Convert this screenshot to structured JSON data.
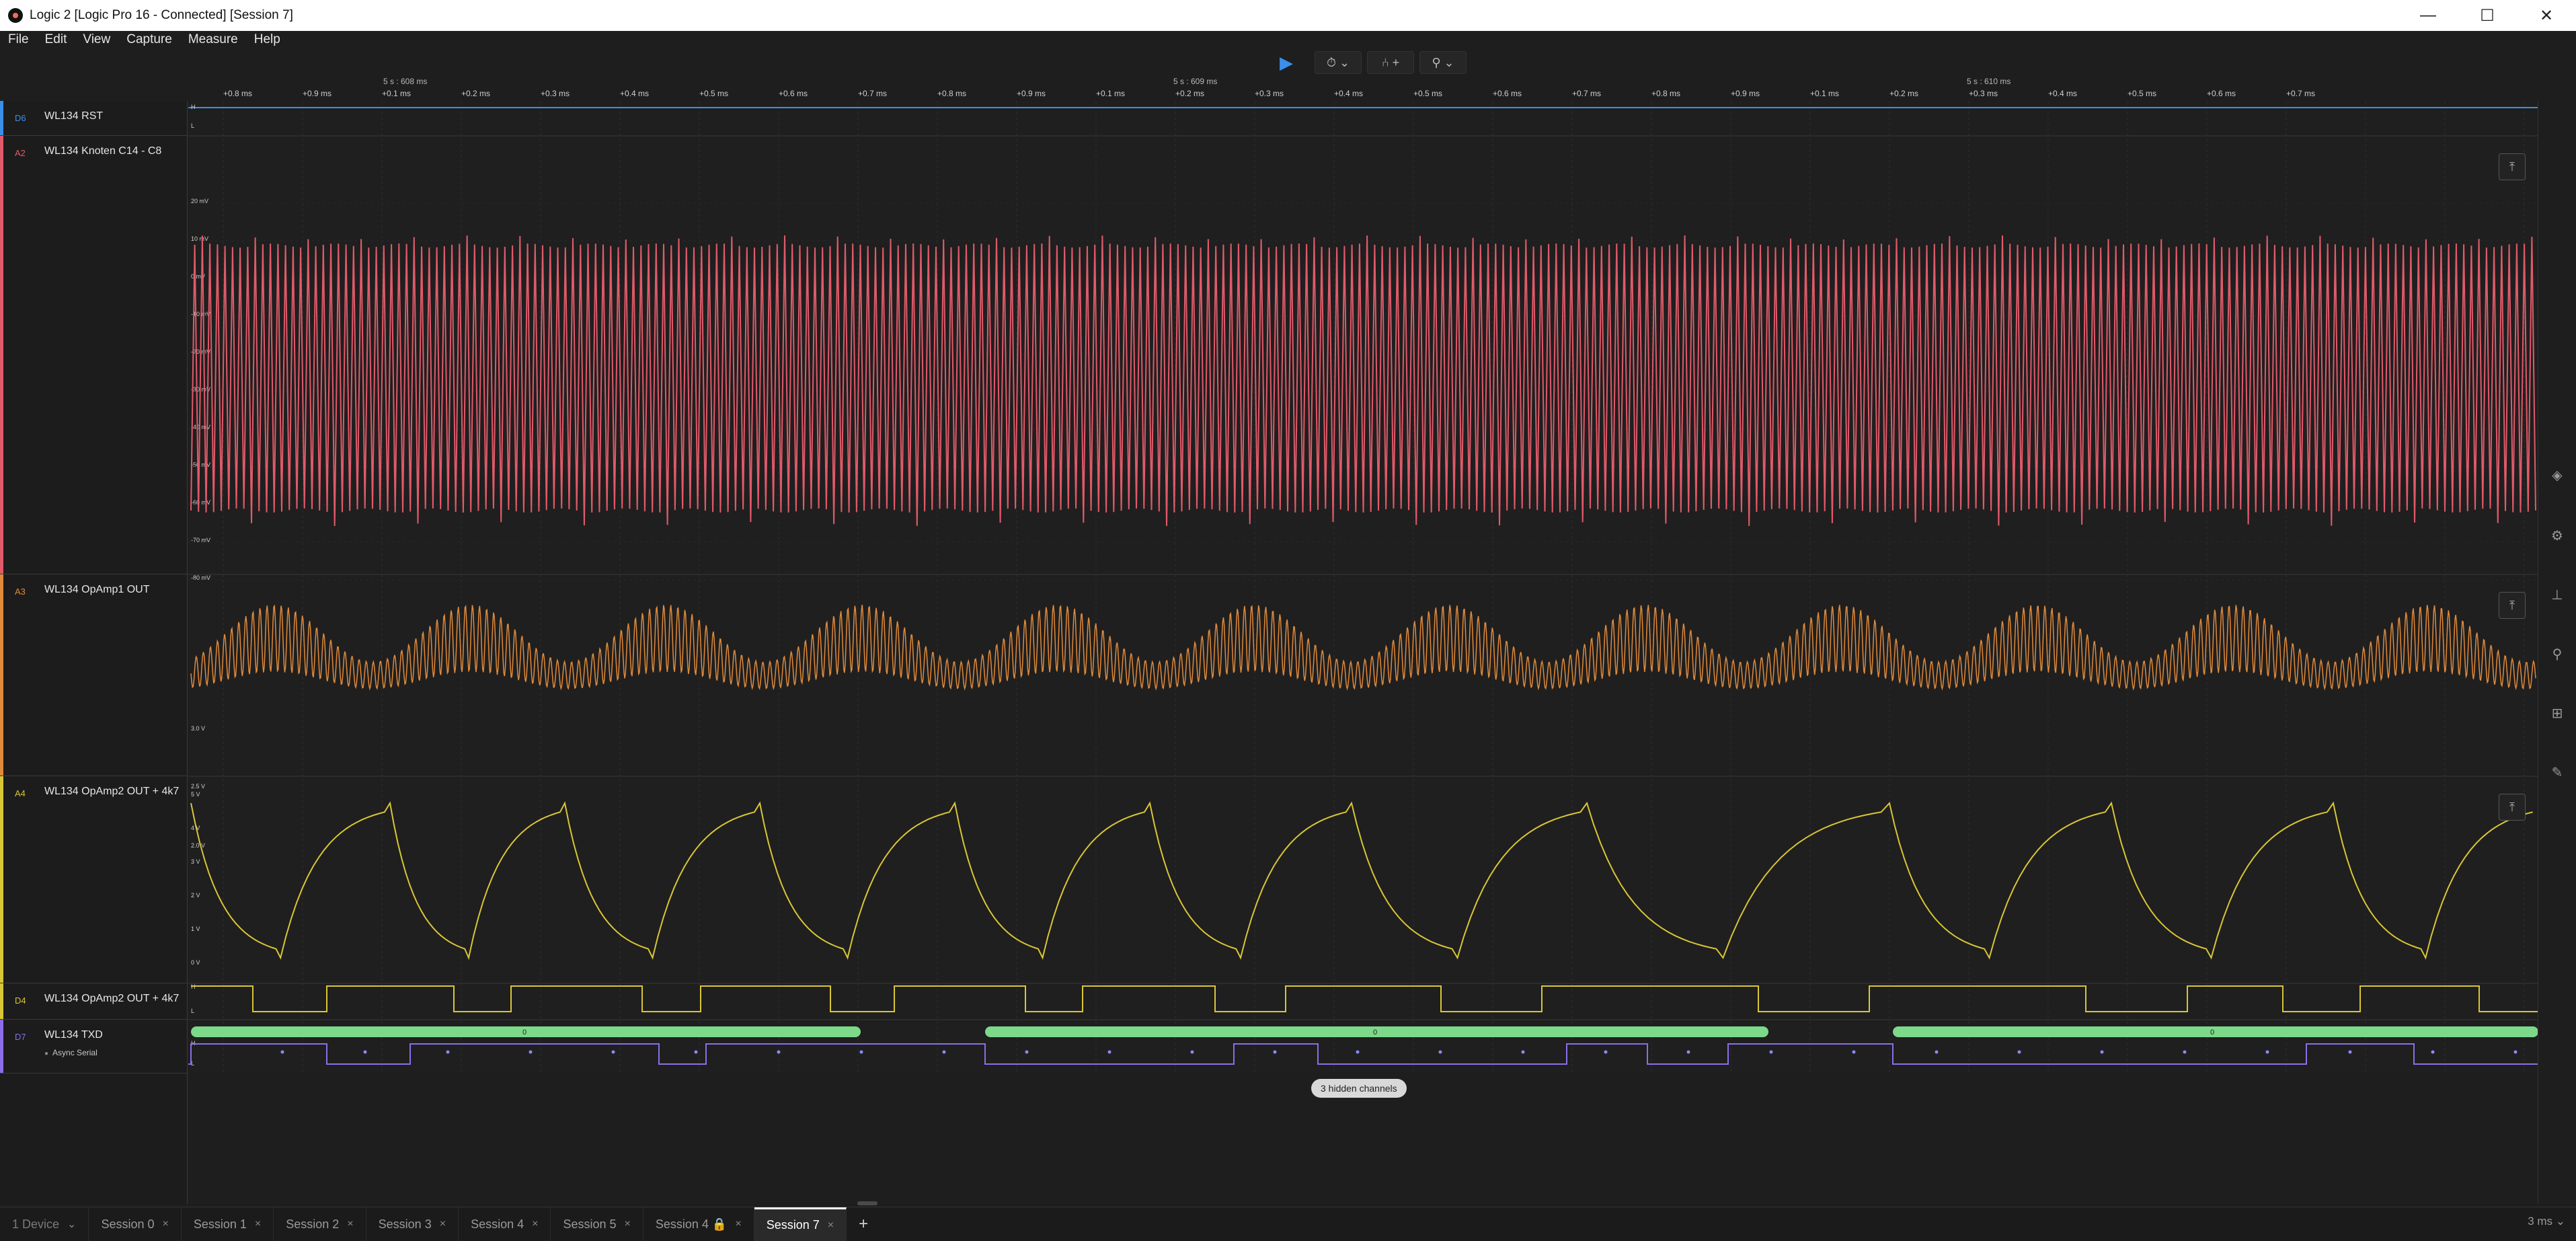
{
  "window": {
    "title": "Logic 2 [Logic Pro 16 - Connected] [Session 7]",
    "minimize_label": "—",
    "maximize_label": "☐",
    "close_label": "✕"
  },
  "menu": [
    "File",
    "Edit",
    "View",
    "Capture",
    "Measure",
    "Help"
  ],
  "toolbar": {
    "play_icon": "play-icon",
    "timer_label": "⏱ ⌄",
    "trigger_label": "⑃ +",
    "marker_label": "⚲ ⌄"
  },
  "ruler": {
    "major_labels": [
      {
        "text": "5 s : 608 ms"
      },
      {
        "text": "5 s : 609 ms"
      },
      {
        "text": "5 s : 610 ms"
      }
    ],
    "minor_labels": [
      "+0.8 ms",
      "+0.9 ms",
      "+0.1 ms",
      "+0.2 ms",
      "+0.3 ms",
      "+0.4 ms",
      "+0.5 ms",
      "+0.6 ms",
      "+0.7 ms",
      "+0.8 ms",
      "+0.9 ms",
      "+0.1 ms",
      "+0.2 ms",
      "+0.3 ms",
      "+0.4 ms",
      "+0.5 ms",
      "+0.6 ms",
      "+0.7 ms",
      "+0.8 ms",
      "+0.9 ms",
      "+0.1 ms",
      "+0.2 ms",
      "+0.3 ms",
      "+0.4 ms",
      "+0.5 ms",
      "+0.6 ms",
      "+0.7 ms"
    ]
  },
  "channels": [
    {
      "id": "D6",
      "name": "WL134 RST",
      "color": "#3b8fe8"
    },
    {
      "id": "A2",
      "name": "WL134 Knoten C14 - C8",
      "color": "#e05a6a"
    },
    {
      "id": "A3",
      "name": "WL134 OpAmp1 OUT",
      "color": "#e08a3b"
    },
    {
      "id": "A4",
      "name": "WL134 OpAmp2 OUT + 4k7",
      "color": "#d9c636"
    },
    {
      "id": "D4",
      "name": "WL134 OpAmp2 OUT + 4k7",
      "color": "#d9c636"
    },
    {
      "id": "D7",
      "name": "WL134 TXD",
      "color": "#8b6ee8",
      "analyzer": "Async Serial"
    }
  ],
  "axis_labels": {
    "d6": [
      "H",
      "L"
    ],
    "a2": [
      "20 mV",
      "10 mV",
      "0 mV",
      "-10 mV",
      "-20 mV",
      "-30 mV",
      "-40 mV",
      "-50 mV",
      "-60 mV",
      "-70 mV",
      "-80 mV"
    ],
    "a3": [
      "3.0 V",
      "2.5 V",
      "2.0 V"
    ],
    "a4": [
      "5 V",
      "4 V",
      "3 V",
      "2 V",
      "1 V",
      "0 V"
    ],
    "d4": [
      "H",
      "L"
    ],
    "d7": [
      "H",
      "L"
    ]
  },
  "serial_frames": [
    "0",
    "0",
    "0"
  ],
  "hidden_channels": "3 hidden channels",
  "tabs": [
    {
      "label": "1 Device",
      "kind": "device"
    },
    {
      "label": "Session 0"
    },
    {
      "label": "Session 1"
    },
    {
      "label": "Session 2"
    },
    {
      "label": "Session 3"
    },
    {
      "label": "Session 4"
    },
    {
      "label": "Session 5"
    },
    {
      "label": "Session 4 🔒"
    },
    {
      "label": "Session 7",
      "active": true
    }
  ],
  "add_tab_label": "+",
  "tab_close_label": "×",
  "zoom_readout": "3 ms ⌄",
  "colors": {
    "background": "#1e1e1e",
    "grid": "#2f2f2f",
    "serial_bubble": "#7dd98a"
  }
}
